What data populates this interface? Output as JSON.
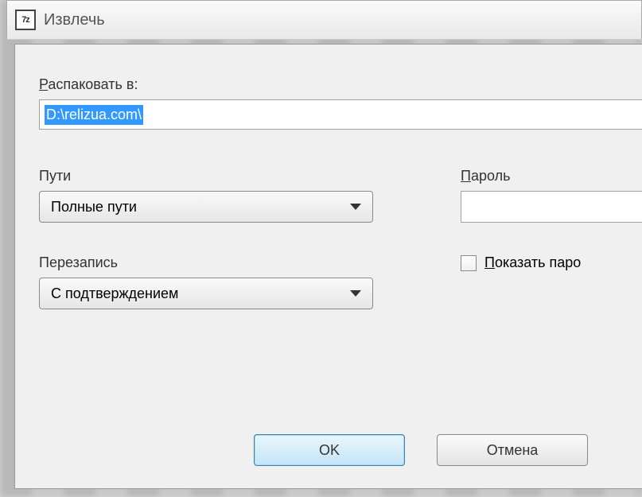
{
  "app": {
    "icon_text": "7z",
    "title": "Извлечь"
  },
  "dialog": {
    "extract_to": {
      "label_prefix": "Р",
      "label_rest": "аспаковать в:",
      "value": "D:\\relizua.com\\"
    },
    "left": {
      "paths_label": "Пути",
      "paths_value": "Полные пути",
      "overwrite_label": "Перезапись",
      "overwrite_value": "С подтверждением"
    },
    "right": {
      "password_label_u": "П",
      "password_label_rest": "ароль",
      "password_value": "",
      "show_password_u": "П",
      "show_password_rest": "оказать паро"
    },
    "buttons": {
      "ok": "OK",
      "cancel": "Отмена"
    }
  }
}
